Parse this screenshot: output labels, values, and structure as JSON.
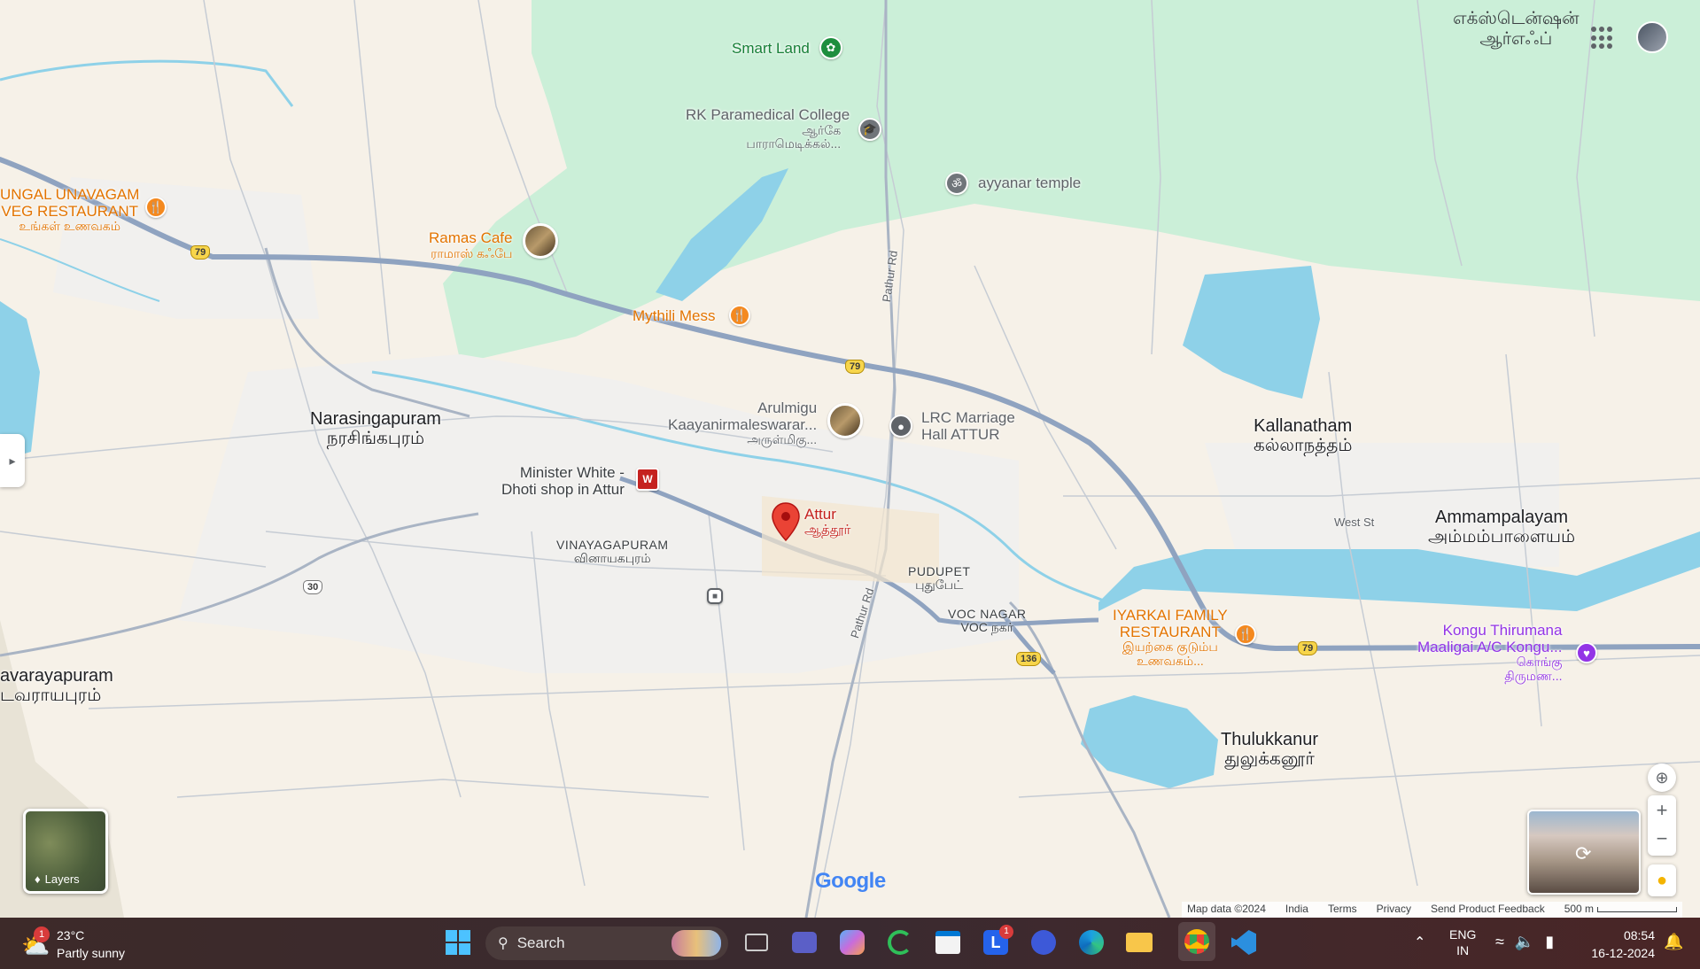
{
  "map": {
    "top_right_place": {
      "line1": "எக்ஸ்டென்ஷன்",
      "line2": "ஆர்எஃப்"
    },
    "places": {
      "narasingapuram": {
        "en": "Narasingapuram",
        "ta": "நரசிங்கபுரம்"
      },
      "kallanatham": {
        "en": "Kallanatham",
        "ta": "கல்லாநத்தம்"
      },
      "ammampalayam": {
        "en": "Ammampalayam",
        "ta": "அம்மம்பாளையம்"
      },
      "thulukkanur": {
        "en": "Thulukkanur",
        "ta": "துலுக்கனூர்"
      },
      "avarayapuram": {
        "en": "avarayapuram",
        "ta": "டவராயபுரம்"
      },
      "vinayagapuram": {
        "en": "VINAYAGAPURAM",
        "ta": "வினாயகபுரம்"
      },
      "pudupet": {
        "en": "PUDUPET",
        "ta": "புதுபேட்"
      },
      "voc_nagar": {
        "en": "VOC NAGAR",
        "ta": "VOC நகர்"
      }
    },
    "pois": {
      "smart_land": {
        "name": "Smart Land"
      },
      "rk_college": {
        "name": "RK Paramedical College",
        "sub1": "ஆர்கே",
        "sub2": "பாராமெடிக்கல்..."
      },
      "ayyanar": {
        "name": "ayyanar temple"
      },
      "ungal": {
        "name1": "UNGAL UNAVAGAM",
        "name2": "VEG RESTAURANT",
        "sub": "உங்கள் உணவகம்"
      },
      "ramas": {
        "name": "Ramas Cafe",
        "sub": "ராமாஸ் கஃபே"
      },
      "mythili": {
        "name": "Mythili Mess"
      },
      "arulmigu": {
        "name1": "Arulmigu",
        "name2": "Kaayanirmaleswarar...",
        "sub": "அருள்மிகு..."
      },
      "lrc": {
        "name1": "LRC Marriage",
        "name2": "Hall ATTUR"
      },
      "minister": {
        "name1": "Minister White -",
        "name2": "Dhoti shop in Attur"
      },
      "attur": {
        "name": "Attur",
        "sub": "ஆத்தூர்"
      },
      "iyarkai": {
        "name1": "IYARKAI FAMILY",
        "name2": "RESTAURANT",
        "sub1": "இயற்கை குடும்ப",
        "sub2": "உணவகம்..."
      },
      "kongu": {
        "name1": "Kongu Thirumana",
        "name2": "Maaligai A/C Kongu...",
        "sub1": "கொங்கு",
        "sub2": "திருமண..."
      }
    },
    "roads": {
      "r79": "79",
      "r30": "30",
      "r136": "136",
      "pathur_rd": "Pathur Rd",
      "west_st": "West St"
    },
    "layers_label": "Layers",
    "google_logo": "Google",
    "footer": {
      "map_data": "Map data ©2024",
      "country": "India",
      "terms": "Terms",
      "privacy": "Privacy",
      "feedback": "Send Product Feedback",
      "scale": "500 m"
    }
  },
  "taskbar": {
    "weather_temp": "23°C",
    "weather_desc": "Partly sunny",
    "weather_badge": "1",
    "search_label": "Search",
    "lang_line1": "ENG",
    "lang_line2": "IN",
    "time": "08:54",
    "date": "16-12-2024",
    "app_badge": "1"
  },
  "colors": {
    "water": "#8ed1e8",
    "park": "#c8f0d8",
    "land": "#f6f1e8",
    "highway": "#8fa3c0",
    "pin_red": "#ea4335"
  }
}
